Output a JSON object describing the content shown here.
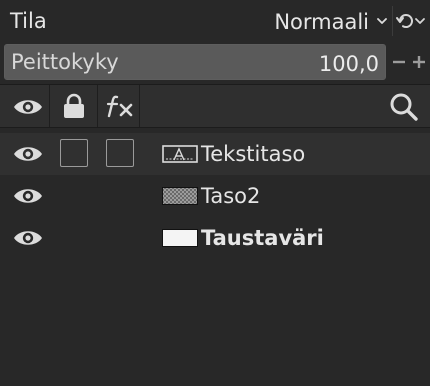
{
  "mode": {
    "label": "Tila",
    "value": "Normaali"
  },
  "opacity": {
    "label": "Peittokyky",
    "value": "100,0",
    "level_percent": 100
  },
  "columns": {
    "visibility_icon": "eye-icon",
    "lock_icon": "lock-icon",
    "effects_icon": "fx-icon",
    "search_icon": "search-icon"
  },
  "layers": [
    {
      "name": "Tekstitaso",
      "type": "text",
      "visible": true,
      "selected": true,
      "bold": false
    },
    {
      "name": "Taso2",
      "type": "transparent",
      "visible": true,
      "selected": false,
      "bold": false
    },
    {
      "name": "Taustaväri",
      "type": "background",
      "visible": true,
      "selected": false,
      "bold": true
    }
  ]
}
